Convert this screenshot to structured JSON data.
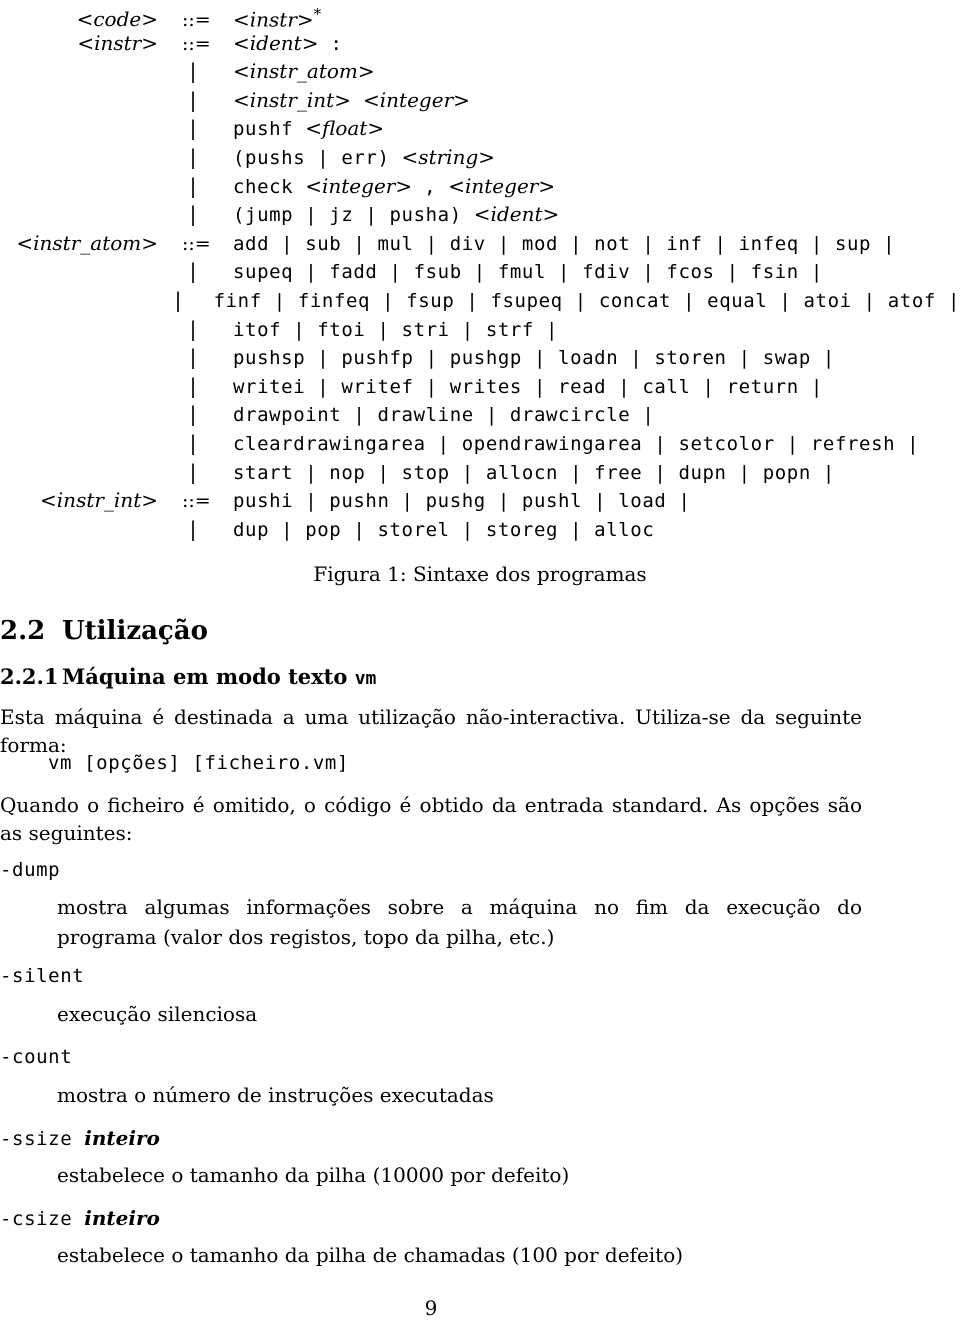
{
  "figure": {
    "caption": "Figura 1: Sintaxe dos programas",
    "grammar_rows": [
      {
        "lhs": "<code>",
        "op": "::=",
        "rhs_plain": "<instr>*",
        "kind": "nonterminal-star"
      },
      {
        "lhs": "<instr>",
        "op": "::=",
        "rhs_plain": "<ident> :",
        "kind": "mixed"
      },
      {
        "lhs": "",
        "op": "|",
        "rhs_plain": "<instr_atom>",
        "kind": "nonterminal"
      },
      {
        "lhs": "",
        "op": "|",
        "rhs_plain": "<instr_int> <integer>",
        "kind": "nonterminal"
      },
      {
        "lhs": "",
        "op": "|",
        "rhs_plain": "pushf <float>",
        "kind": "mixed"
      },
      {
        "lhs": "",
        "op": "|",
        "rhs_plain": "(pushs | err) <string>",
        "kind": "mixed"
      },
      {
        "lhs": "",
        "op": "|",
        "rhs_plain": "check <integer> , <integer>",
        "kind": "mixed"
      },
      {
        "lhs": "",
        "op": "|",
        "rhs_plain": "(jump | jz | pusha) <ident>",
        "kind": "mixed"
      },
      {
        "lhs": "<instr_atom>",
        "op": "::=",
        "rhs_plain": "add | sub | mul | div | mod | not | inf | infeq | sup |",
        "kind": "terminals"
      },
      {
        "lhs": "",
        "op": "|",
        "rhs_plain": "supeq | fadd | fsub | fmul | fdiv | fcos | fsin |",
        "kind": "terminals"
      },
      {
        "lhs": "",
        "op": "|",
        "rhs_plain": "finf | finfeq | fsup | fsupeq | concat | equal | atoi | atof |",
        "kind": "terminals"
      },
      {
        "lhs": "",
        "op": "|",
        "rhs_plain": "itof | ftoi | stri | strf |",
        "kind": "terminals"
      },
      {
        "lhs": "",
        "op": "|",
        "rhs_plain": "pushsp | pushfp | pushgp | loadn | storen | swap |",
        "kind": "terminals"
      },
      {
        "lhs": "",
        "op": "|",
        "rhs_plain": "writei | writef | writes | read | call | return |",
        "kind": "terminals"
      },
      {
        "lhs": "",
        "op": "|",
        "rhs_plain": "drawpoint | drawline | drawcircle |",
        "kind": "terminals"
      },
      {
        "lhs": "",
        "op": "|",
        "rhs_plain": "cleardrawingarea | opendrawingarea | setcolor | refresh |",
        "kind": "terminals"
      },
      {
        "lhs": "",
        "op": "|",
        "rhs_plain": "start | nop | stop | allocn | free | dupn | popn |",
        "kind": "terminals"
      },
      {
        "lhs": "<instr_int>",
        "op": "::=",
        "rhs_plain": "pushi | pushn | pushg | pushl | load |",
        "kind": "terminals"
      },
      {
        "lhs": "",
        "op": "|",
        "rhs_plain": "dup | pop | storel | storeg | alloc",
        "kind": "terminals"
      }
    ]
  },
  "headings": {
    "section_number": "2.2",
    "section_title": "Utilização",
    "subsection_number": "2.2.1",
    "subsection_title": "Máquina em modo texto",
    "subsection_mono": "vm"
  },
  "body": {
    "para1": "Esta máquina é destinada a uma utilização não-interactiva. Utiliza-se da seguinte forma:",
    "usage_line": "vm [opções] [ficheiro.vm]",
    "para2": "Quando o ficheiro é omitido, o código é obtido da entrada standard. As opções são as seguintes:"
  },
  "options": [
    {
      "flag": "-dump",
      "arg": "",
      "desc": "mostra algumas informações sobre a máquina no fim da execução do programa (valor dos registos, topo da pilha, etc.)"
    },
    {
      "flag": "-silent",
      "arg": "",
      "desc": "execução silenciosa"
    },
    {
      "flag": "-count",
      "arg": "",
      "desc": "mostra o número de instruções executadas"
    },
    {
      "flag": "-ssize",
      "arg": "inteiro",
      "desc": "estabelece o tamanho da pilha (10000 por defeito)"
    },
    {
      "flag": "-csize",
      "arg": "inteiro",
      "desc": "estabelece o tamanho da pilha de chamadas (100 por defeito)"
    }
  ],
  "footer": {
    "page_number": "9"
  }
}
